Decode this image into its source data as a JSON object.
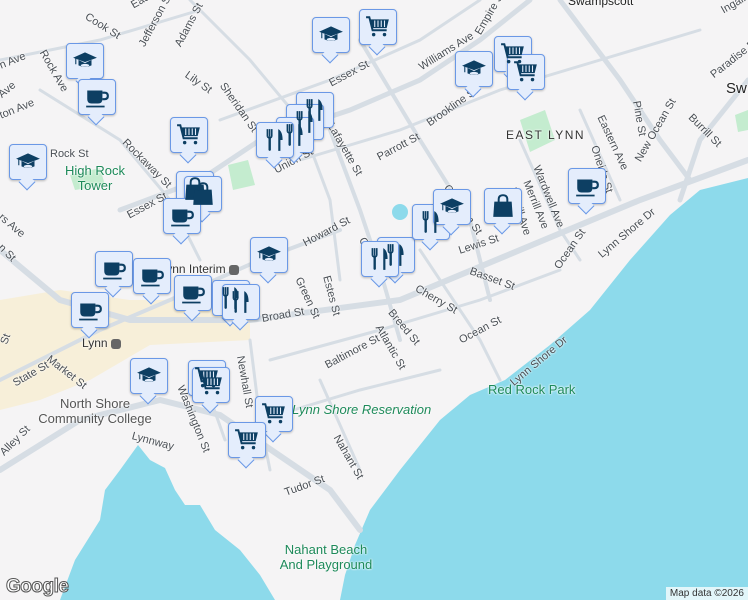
{
  "map": {
    "areas": {
      "east_lynn": "EAST LYNN",
      "swampscott": "Swampscott",
      "swampscott_partial": "Sw"
    },
    "parks": {
      "high_rock": "High Rock Tower",
      "lynn_shore_res": "Lynn Shore Reservation",
      "red_rock": "Red Rock Park",
      "nahant_beach": "Nahant Beach And Playground"
    },
    "pois": {
      "college": "North Shore Community College",
      "lynn_station": "Lynn",
      "lynn_interim": "Lynn Interim"
    },
    "streets": [
      "Cook St",
      "Eade",
      "Jefferson St",
      "Adams St",
      "Lily St",
      "Sheridan St",
      "Rock Ave",
      "Rock St",
      "Rockaway St",
      "Essex St",
      "Essex St",
      "Union St",
      "Howard St",
      "Green St",
      "Estes St",
      "Broad St",
      "Lewis St",
      "Basset St",
      "Cherry St",
      "Breed St",
      "Atlantic St",
      "Ocean St",
      "Ocean St",
      "Baltimore St",
      "Nahant St",
      "Tudor St",
      "Lynnway",
      "Market St",
      "State St",
      "Newhall St",
      "Washington St",
      "Alley St",
      "Parrott St",
      "Brookline St",
      "Williams Ave",
      "Chatham St",
      "Wardwell Ave",
      "Merrill Ave",
      "Burrill Ave",
      "Oneida St",
      "Eastern Ave",
      "Pine St",
      "New Ocean St",
      "Burrill St",
      "Paradise Rd",
      "Lynn Shore Dr",
      "Lynn Shore Dr",
      "Lafayette St",
      "Empire St",
      "Ingalls",
      "ton Ave",
      "n Ave",
      "Ave",
      "rs Ave",
      "n St",
      "St",
      "Ch"
    ],
    "markers": [
      "school",
      "coffee",
      "school",
      "shopping-cart",
      "school",
      "shopping-cart",
      "shopping-cart",
      "school",
      "shopping-cart",
      "restaurant",
      "restaurant",
      "restaurant",
      "restaurant",
      "shopping-bag",
      "shopping-bag",
      "coffee",
      "school",
      "coffee",
      "coffee",
      "coffee",
      "restaurant",
      "restaurant",
      "coffee",
      "school",
      "shopping-cart",
      "shopping-cart",
      "shopping-cart",
      "shopping-cart",
      "restaurant",
      "restaurant",
      "restaurant",
      "school",
      "shopping-bag",
      "coffee"
    ],
    "colors": {
      "water": "#8ddaeb",
      "marker_bg": "#e4edfc",
      "marker_border": "#6a98e6",
      "icon": "#0d3f63",
      "park": "#c4eccf"
    }
  },
  "footer": {
    "attribution": "Map data ©2026",
    "logo": "Google"
  }
}
